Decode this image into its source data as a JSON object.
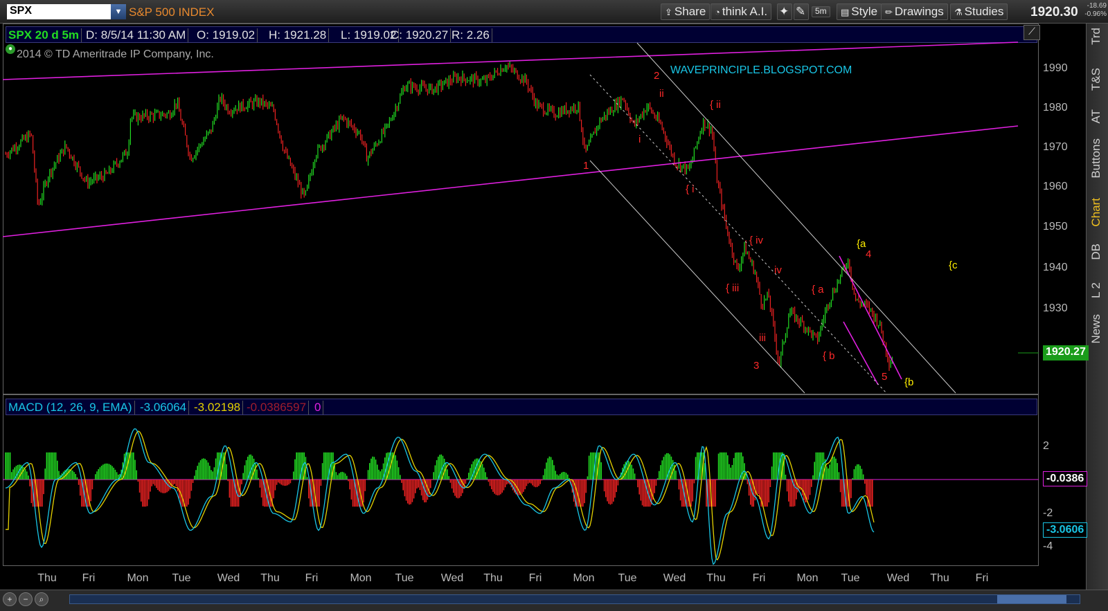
{
  "toolbar": {
    "symbol": "SPX",
    "symbol_description": "S&P 500 INDEX",
    "share_label": "Share",
    "think_ai_label": "think A.I.",
    "interval_badge": "5m",
    "style_label": "Style",
    "drawings_label": "Drawings",
    "studies_label": "Studies",
    "last_price": "1920.30",
    "net_change": "-18.69",
    "pct_change": "-0.96%"
  },
  "side_tabs": [
    "Trd",
    "T&S",
    "AT",
    "Buttons",
    "Chart",
    "DB",
    "L 2",
    "News"
  ],
  "side_tab_active": "Chart",
  "price_info": {
    "symbol": "SPX 20 d 5m",
    "date": "D: 8/5/14 11:30 AM",
    "open": "O: 1919.02",
    "high": "H: 1921.28",
    "low": "L: 1919.02",
    "close": "C: 1920.27",
    "range": "R: 2.26"
  },
  "copyright": "2014 © TD Ameritrade IP Company, Inc.",
  "watermark": "WAVEPRINCIPLE.BLOGSPOT.COM",
  "price_axis": {
    "ticks": [
      "1990",
      "1980",
      "1970",
      "1960",
      "1950",
      "1940",
      "1930"
    ],
    "current_label": "1920.27"
  },
  "macd_info": {
    "name": "MACD (12, 26, 9, EMA)",
    "value": "-3.06064",
    "avg": "-3.02198",
    "diff": "-0.0386597",
    "zero": "0"
  },
  "macd_axis": {
    "ticks": [
      "2",
      "-2",
      "-4"
    ],
    "diff_label": "-0.0386",
    "value_label": "-3.0606"
  },
  "x_axis": [
    "Thu",
    "Fri",
    "Mon",
    "Tue",
    "Wed",
    "Thu",
    "Fri",
    "Mon",
    "Tue",
    "Wed",
    "Thu",
    "Fri",
    "Mon",
    "Tue",
    "Wed",
    "Thu",
    "Fri",
    "Mon",
    "Tue",
    "Wed",
    "Thu",
    "Fri"
  ],
  "wave_labels": [
    {
      "text": "1",
      "color": "red"
    },
    {
      "text": "2",
      "color": "red"
    },
    {
      "text": "3",
      "color": "red"
    },
    {
      "text": "4",
      "color": "red"
    },
    {
      "text": "5",
      "color": "red"
    },
    {
      "text": "i",
      "color": "red"
    },
    {
      "text": "ii",
      "color": "red"
    },
    {
      "text": "iii",
      "color": "red"
    },
    {
      "text": "iv",
      "color": "red"
    },
    {
      "text": "{ i",
      "color": "red"
    },
    {
      "text": "{ ii",
      "color": "red"
    },
    {
      "text": "{ iii",
      "color": "red"
    },
    {
      "text": "{ iv",
      "color": "red"
    },
    {
      "text": "{ a",
      "color": "red"
    },
    {
      "text": "{ b",
      "color": "red"
    },
    {
      "text": "{a",
      "color": "yellow"
    },
    {
      "text": "{b",
      "color": "yellow"
    },
    {
      "text": "{c",
      "color": "yellow"
    }
  ],
  "colors": {
    "up": "#22dd22",
    "down": "#ee2222",
    "channel": "#e020e0",
    "parallel": "#cccccc",
    "macd_line": "#19c6e6",
    "macd_avg": "#e6d200",
    "label_red": "#ff2a2a",
    "label_yellow": "#ffee00"
  }
}
